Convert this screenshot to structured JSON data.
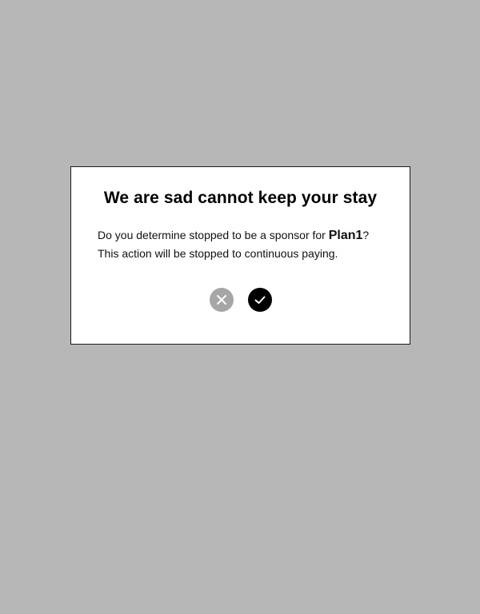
{
  "dialog": {
    "title": "We are sad cannot keep your stay",
    "message_before_plan": "Do you determine stopped to be a sponsor for ",
    "plan_name": "Plan1",
    "message_after_plan": "?",
    "message_line_2": "This action will be stopped to continuous paying.",
    "actions": {
      "cancel_icon": "close-icon",
      "confirm_icon": "check-icon"
    }
  },
  "colors": {
    "page_background": "#b7b7b7",
    "dialog_background": "#ffffff",
    "cancel_button": "#a6a6a6",
    "confirm_button": "#000000"
  }
}
